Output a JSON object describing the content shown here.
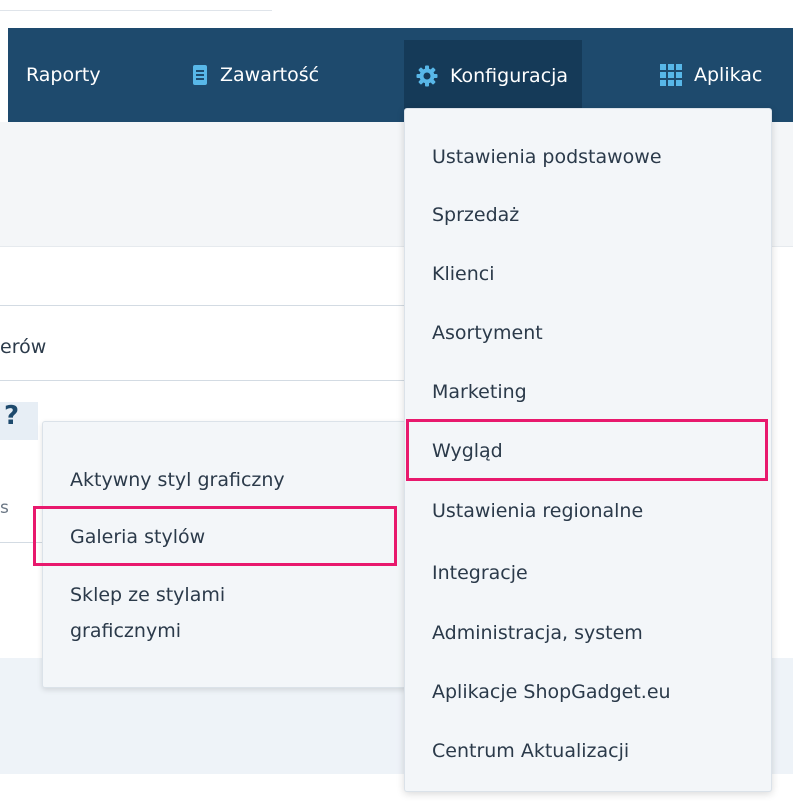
{
  "nav": {
    "items": [
      {
        "label": "Raporty",
        "icon": ""
      },
      {
        "label": "Zawartość",
        "icon": "document-icon"
      },
      {
        "label": "Konfiguracja",
        "icon": "gear-icon",
        "active": true
      },
      {
        "label": "Aplikac",
        "icon": "grid-icon"
      }
    ]
  },
  "background": {
    "partial_label": "erów",
    "question_mark": "?",
    "partial_s": "s"
  },
  "config_menu": {
    "items": [
      "Ustawienia podstawowe",
      "Sprzedaż",
      "Klienci",
      "Asortyment",
      "Marketing",
      "Wygląd",
      "Ustawienia regionalne",
      "Integracje",
      "Administracja, system",
      "Aplikacje ShopGadget.eu",
      "Centrum Aktualizacji"
    ],
    "highlighted": "Wygląd"
  },
  "appearance_submenu": {
    "items": [
      "Aktywny styl graficzny",
      "Galeria stylów",
      "Sklep ze stylami graficznymi"
    ],
    "highlighted": "Galeria stylów"
  },
  "colors": {
    "navbar": "#1e4a6d",
    "navbar_active": "#153a58",
    "accent_icon": "#58b7e8",
    "highlight": "#e8196d",
    "menu_bg": "#f3f6f9"
  }
}
